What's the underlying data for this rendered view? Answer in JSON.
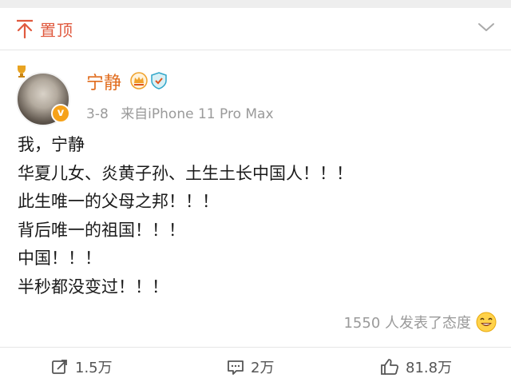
{
  "pinned": {
    "label": "置顶"
  },
  "post": {
    "author": "宁静",
    "time": "3-8",
    "source": "来自iPhone 11 Pro Max",
    "verified_mark": "v",
    "lines": [
      "我，宁静",
      "华夏儿女、炎黄子孙、土生土长中国人！！！",
      "此生唯一的父母之邦！！！",
      "背后唯一的祖国！！！",
      "中国！！！",
      "半秒都没变过！！！"
    ],
    "reactions_text": "1550 人发表了态度"
  },
  "actions": {
    "repost": "1.5万",
    "comment": "2万",
    "like": "81.8万"
  },
  "colors": {
    "accent_orange": "#e06b1c",
    "pin_red": "#e05a3f",
    "muted": "#9a9a9a"
  }
}
